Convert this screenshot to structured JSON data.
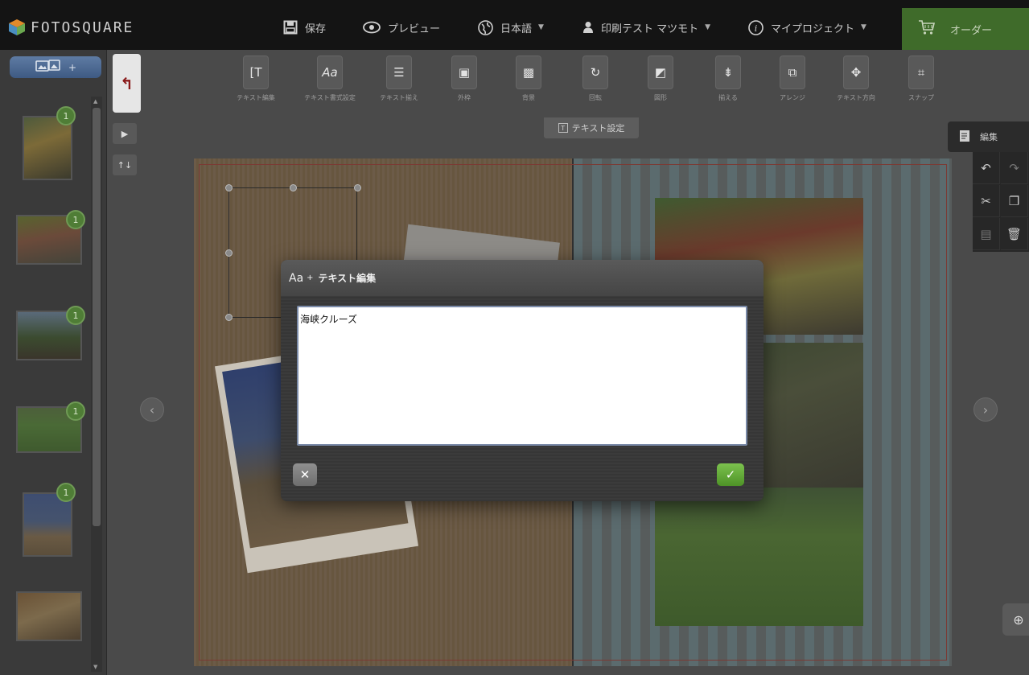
{
  "topbar": {
    "logo_text": "FOTOSQUARE",
    "save_label": "保存",
    "preview_label": "プレビュー",
    "language_label": "日本語",
    "user_label": "印刷テスト マツモト",
    "my_project_label": "マイプロジェクト",
    "order_label": "オーダー",
    "icons": [
      "save-icon",
      "eye-icon",
      "globe-icon",
      "user-icon",
      "info-icon",
      "cart-icon"
    ]
  },
  "sidebar": {
    "add_photo_icon": "add-photos-icon",
    "thumbnails": [
      {
        "badge": "1"
      },
      {
        "badge": "1"
      },
      {
        "badge": "1"
      },
      {
        "badge": "1"
      },
      {
        "badge": "1"
      },
      {
        "badge": ""
      }
    ]
  },
  "toolbar": {
    "tools": [
      {
        "label": "テキスト編集",
        "icon": "text-edit-icon"
      },
      {
        "label": "テキスト書式設定",
        "icon": "text-format-icon"
      },
      {
        "label": "テキスト揃え",
        "icon": "text-align-icon"
      },
      {
        "label": "外枠",
        "icon": "frame-icon"
      },
      {
        "label": "背景",
        "icon": "background-icon"
      },
      {
        "label": "回転",
        "icon": "rotate-icon"
      },
      {
        "label": "図形",
        "icon": "shape-icon"
      },
      {
        "label": "揃える",
        "icon": "align-icon"
      },
      {
        "label": "アレンジ",
        "icon": "arrange-icon"
      },
      {
        "label": "テキスト方向",
        "icon": "text-direction-icon"
      },
      {
        "label": "スナップ",
        "icon": "snap-icon"
      }
    ],
    "text_settings_label": "テキスト設定"
  },
  "edit_panel": {
    "title": "編集",
    "icons": [
      "undo-icon",
      "redo-icon",
      "cut-icon",
      "copy-icon",
      "paste-icon",
      "trash-icon"
    ]
  },
  "modal": {
    "title_prefix": "Aa",
    "title_plus": "+",
    "title": "テキスト編集",
    "text_value": "海峡クルーズ",
    "cancel_icon": "close-icon",
    "ok_icon": "check-icon"
  },
  "colors": {
    "topbar_bg": "#141414",
    "order_green": "#3f6b2a",
    "badge_green": "#4f7d36",
    "ok_green": "#5fa836",
    "spread_border": "#7b3a34"
  }
}
